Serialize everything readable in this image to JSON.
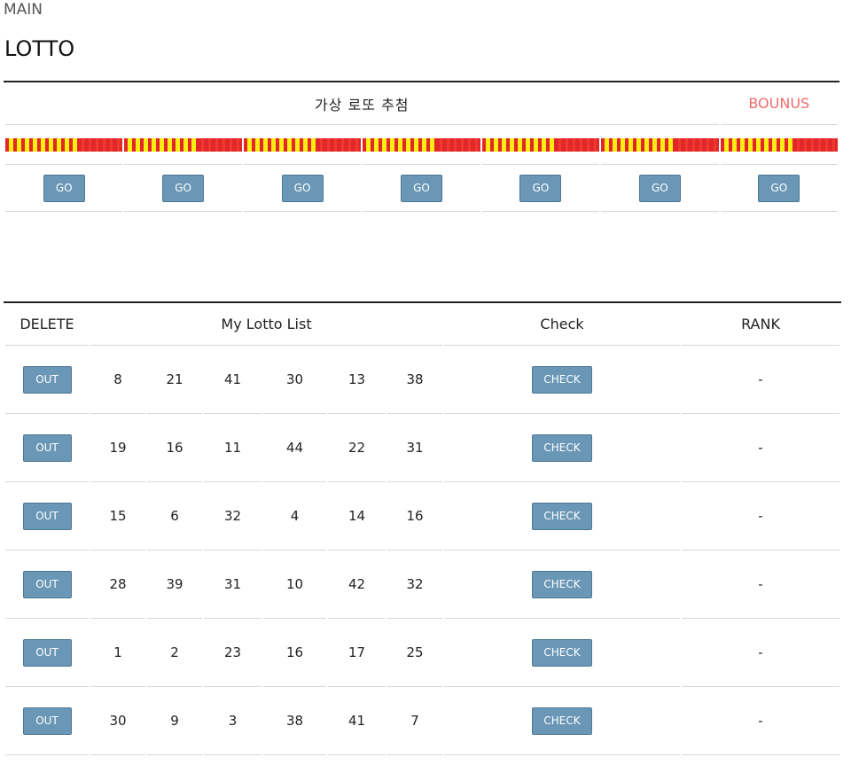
{
  "nav": {
    "main": "MAIN"
  },
  "page": {
    "title": "LOTTO"
  },
  "draw": {
    "title": "가상 로또 추첨",
    "bonus_label": "BOUNUS",
    "go_label": "GO",
    "slots": 7,
    "stripe_colors": [
      "#e3262a",
      "#f7ee12"
    ]
  },
  "list": {
    "headers": {
      "delete": "DELETE",
      "numbers": "My Lotto List",
      "check": "Check",
      "rank": "RANK"
    },
    "out_label": "OUT",
    "check_label": "CHECK",
    "rows": [
      {
        "numbers": [
          "8",
          "21",
          "41",
          "30",
          "13",
          "38"
        ],
        "rank": "-"
      },
      {
        "numbers": [
          "19",
          "16",
          "11",
          "44",
          "22",
          "31"
        ],
        "rank": "-"
      },
      {
        "numbers": [
          "15",
          "6",
          "32",
          "4",
          "14",
          "16"
        ],
        "rank": "-"
      },
      {
        "numbers": [
          "28",
          "39",
          "31",
          "10",
          "42",
          "32"
        ],
        "rank": "-"
      },
      {
        "numbers": [
          "1",
          "2",
          "23",
          "16",
          "17",
          "25"
        ],
        "rank": "-"
      },
      {
        "numbers": [
          "30",
          "9",
          "3",
          "38",
          "41",
          "7"
        ],
        "rank": "-"
      }
    ]
  },
  "colors": {
    "button": "#6a97b6",
    "bonus": "#f06b6b"
  }
}
